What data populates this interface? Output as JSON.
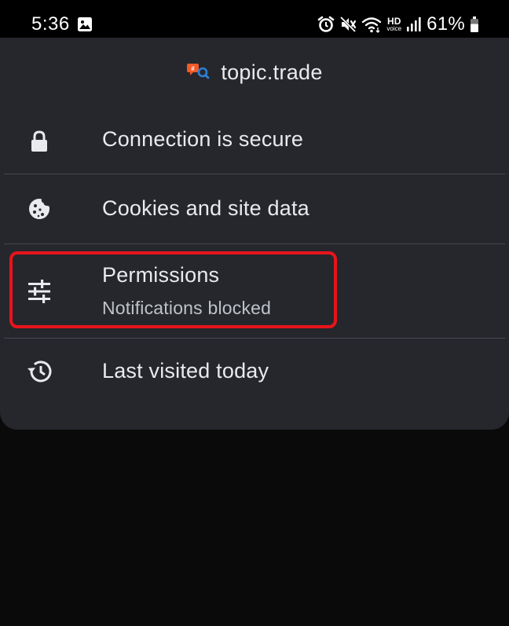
{
  "status_bar": {
    "time": "5:36",
    "battery": "61%",
    "network_badge_top": "HD",
    "network_badge_bottom": "voice",
    "icons": [
      "gallery-icon",
      "alarm-icon",
      "mute-icon",
      "wifi-icon",
      "hd-voice-icon",
      "signal-icon",
      "battery-icon"
    ]
  },
  "site": {
    "domain": "topic.trade",
    "favicon": "topic-trade-favicon",
    "favicon_colors": {
      "primary": "#f05a28",
      "secondary": "#2f7fd6"
    }
  },
  "items": [
    {
      "label": "Connection is secure",
      "icon": "lock-icon"
    },
    {
      "label": "Cookies and site data",
      "icon": "cookie-icon"
    },
    {
      "label": "Permissions",
      "sublabel": "Notifications blocked",
      "icon": "tune-icon",
      "highlighted": true
    },
    {
      "label": "Last visited today",
      "icon": "history-icon"
    }
  ],
  "colors": {
    "sheet": "#25272c",
    "text": "#e8eaed",
    "highlight": "#e8141b"
  }
}
